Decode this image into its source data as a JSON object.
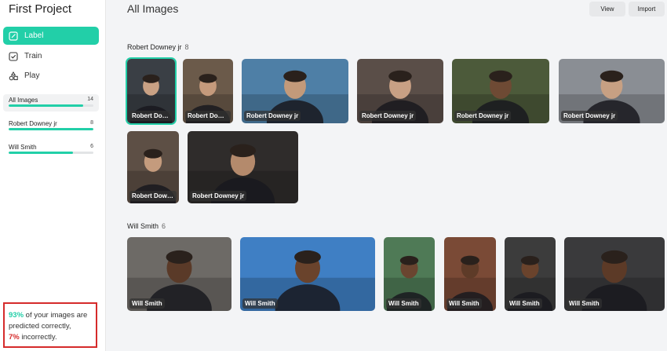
{
  "project": {
    "title": "First Project"
  },
  "nav": [
    {
      "label": "Label",
      "icon": "edit-icon",
      "active": true
    },
    {
      "label": "Train",
      "icon": "checkbox-icon",
      "active": false
    },
    {
      "label": "Play",
      "icon": "shapes-icon",
      "active": false
    }
  ],
  "filters": [
    {
      "name": "All Images",
      "count": "14",
      "progress": 0.88,
      "selected": true
    },
    {
      "name": "Robert Downey jr",
      "count": "8",
      "progress": 1.0,
      "selected": false
    },
    {
      "name": "Will Smith",
      "count": "6",
      "progress": 0.76,
      "selected": false
    }
  ],
  "accuracy": {
    "correct_pct": "93%",
    "correct_text": "of your images are predicted correctly,",
    "incorrect_pct": "7%",
    "incorrect_text": "incorrectly."
  },
  "header": {
    "title": "All Images",
    "view_label": "View",
    "import_label": "Import"
  },
  "groups": [
    {
      "name": "Robert Downey jr",
      "count": "8",
      "images": [
        {
          "label": "Robert Downey jr",
          "tone": "#3a3f45",
          "skin": "#c9a184",
          "selected": true
        },
        {
          "label": "Robert Downey jr",
          "tone": "#6b5a4a",
          "skin": "#c59a7c",
          "selected": false
        },
        {
          "label": "Robert Downey jr",
          "tone": "#4e7fa6",
          "skin": "#c39a7a",
          "selected": false
        },
        {
          "label": "Robert Downey jr",
          "tone": "#5a4e48",
          "skin": "#c8a084",
          "selected": false
        },
        {
          "label": "Robert Downey jr",
          "tone": "#4c5a3a",
          "skin": "#6e4a34",
          "selected": false
        },
        {
          "label": "Robert Downey jr",
          "tone": "#8a8e94",
          "skin": "#c7a083",
          "selected": false
        },
        {
          "label": "Robert Downey jr",
          "tone": "#5d4f45",
          "skin": "#c49b7d",
          "selected": false
        },
        {
          "label": "Robert Downey jr",
          "tone": "#2f2c2b",
          "skin": "#b48a6c",
          "selected": false
        }
      ]
    },
    {
      "name": "Will Smith",
      "count": "6",
      "images": [
        {
          "label": "Will Smith",
          "tone": "#6d6a66",
          "skin": "#5a3a28",
          "selected": false
        },
        {
          "label": "Will Smith",
          "tone": "#3f7fc4",
          "skin": "#6a432c",
          "selected": false
        },
        {
          "label": "Will Smith",
          "tone": "#4f7a56",
          "skin": "#6a4530",
          "selected": false
        },
        {
          "label": "Will Smith",
          "tone": "#7a4a36",
          "skin": "#5e3b28",
          "selected": false
        },
        {
          "label": "Will Smith",
          "tone": "#3c3c3c",
          "skin": "#6a432c",
          "selected": false
        },
        {
          "label": "Will Smith",
          "tone": "#3a3a3c",
          "skin": "#5c3a27",
          "selected": false
        }
      ]
    }
  ],
  "colors": {
    "accent": "#22cfa8",
    "alert": "#d52b2b"
  }
}
